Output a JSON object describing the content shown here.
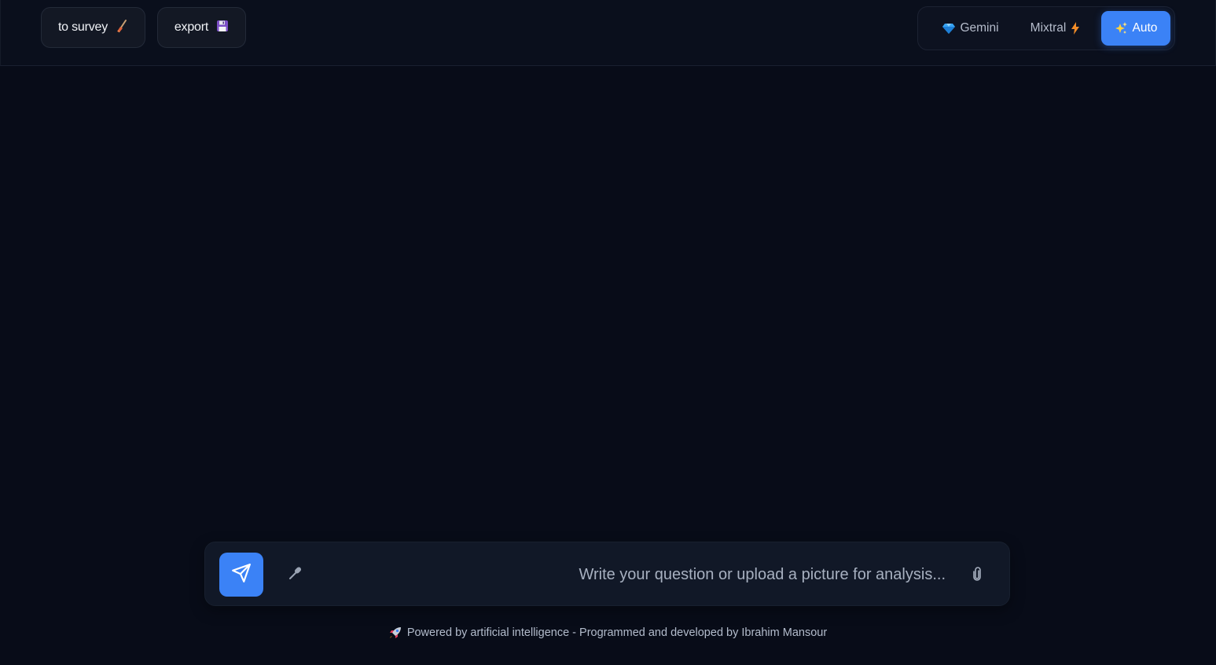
{
  "header": {
    "survey_label": "to survey",
    "survey_icon": "broom-icon",
    "export_label": "export",
    "export_icon": "floppy-disk-icon"
  },
  "models": {
    "options": [
      {
        "label": "Gemini",
        "icon": "gem-icon",
        "selected": false
      },
      {
        "label": "Mixtral",
        "icon": "lightning-icon",
        "selected": false
      },
      {
        "label": "Auto",
        "icon": "sparkles-icon",
        "selected": true
      }
    ],
    "accent_color": "#3b82f6"
  },
  "composer": {
    "placeholder": "...Write your question or upload a picture for analysis",
    "value": "",
    "send_icon": "paper-plane-icon",
    "mic_icon": "microphone-icon",
    "attach_icon": "paperclip-icon"
  },
  "footer": {
    "text": "Powered by artificial intelligence - Programmed and developed by Ibrahim Mansour",
    "icon": "rocket-icon"
  },
  "colors": {
    "background": "#080c18",
    "panel": "#111827",
    "accent": "#3b82f6"
  }
}
